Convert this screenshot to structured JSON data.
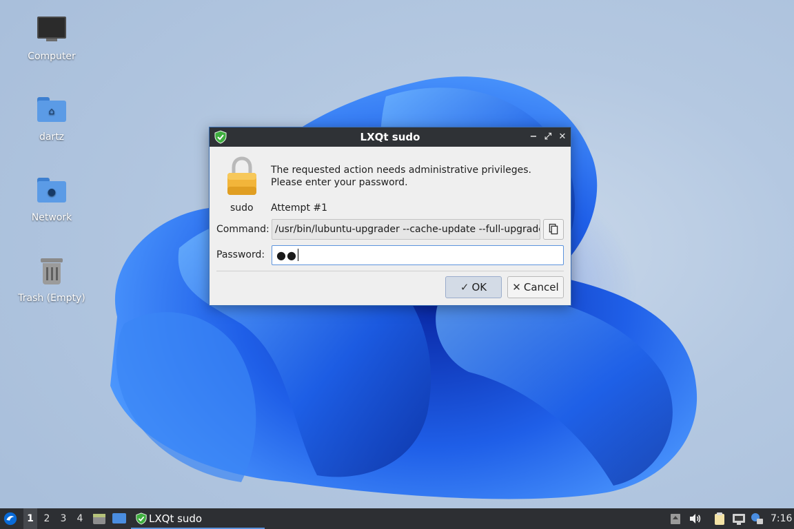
{
  "desktop": {
    "icons": [
      {
        "label": "Computer",
        "icon": "computer-icon"
      },
      {
        "label": "dartz",
        "icon": "home-folder-icon"
      },
      {
        "label": "Network",
        "icon": "network-folder-icon"
      },
      {
        "label": "Trash (Empty)",
        "icon": "trash-icon"
      }
    ]
  },
  "dialog": {
    "title": "LXQt sudo",
    "title_icon": "shield-check-icon",
    "lock_label": "sudo",
    "message_line1": "The requested action needs administrative privileges.",
    "message_line2": "Please enter your password.",
    "attempt": "Attempt #1",
    "command_label": "Command:",
    "command_value": "/usr/bin/lubuntu-upgrader --cache-update --full-upgrade",
    "password_label": "Password:",
    "password_value": "●●",
    "ok_label": "OK",
    "cancel_label": "Cancel"
  },
  "taskbar": {
    "workspaces": [
      "1",
      "2",
      "3",
      "4"
    ],
    "active_workspace": "1",
    "task_label": "LXQt sudo",
    "clock": "7:16"
  },
  "colors": {
    "accent": "#5b93dc",
    "titlebar": "#2f3236",
    "shield_green": "#3fae3f",
    "lock_gold": "#f2b53a"
  }
}
